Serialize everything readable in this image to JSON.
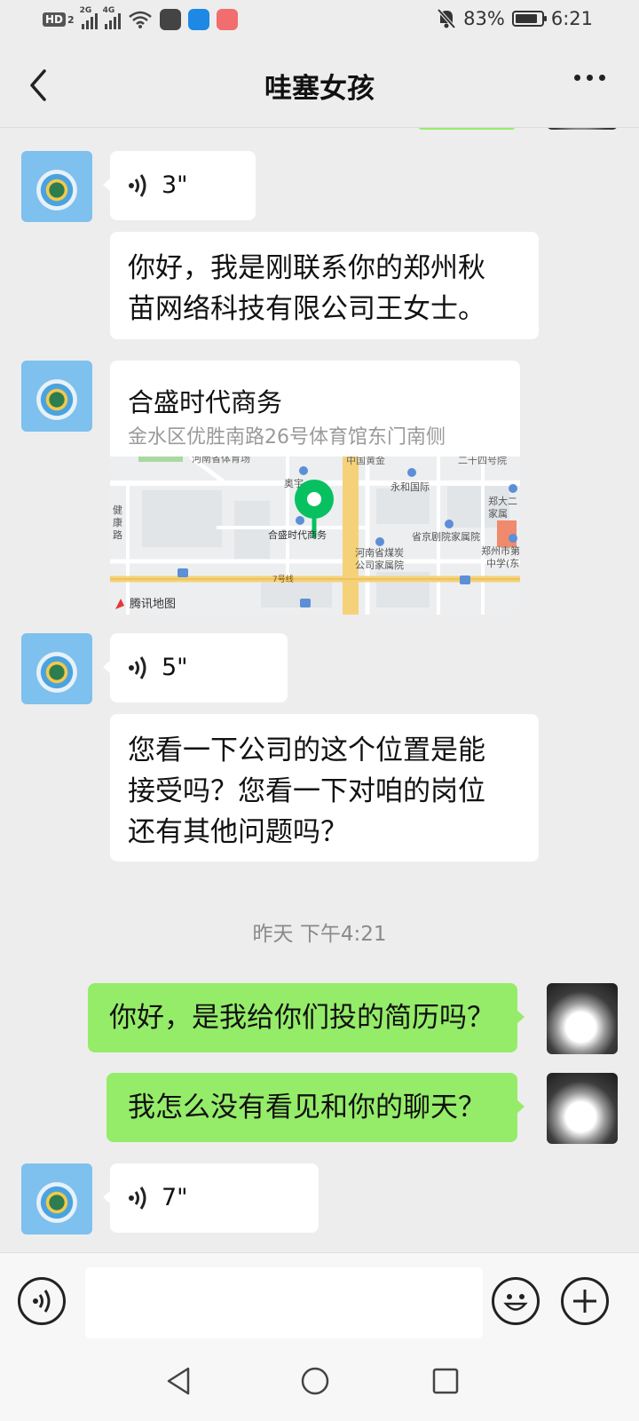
{
  "status_bar": {
    "hd": "HD",
    "hd_sub": "2",
    "sim1": "2G",
    "sim2": "4G",
    "battery_percent": "83%",
    "time": "6:21"
  },
  "nav": {
    "title": "哇塞女孩"
  },
  "messages": [
    {
      "side": "received",
      "type": "voice",
      "duration": "3\""
    },
    {
      "side": "received",
      "type": "text",
      "lines": [
        "你好，我是刚联系你的郑州秋",
        "苗网络科技有限公司王女士。"
      ]
    },
    {
      "side": "received",
      "type": "location",
      "name": "合盛时代商务",
      "address": "金水区优胜南路26号体育馆东门南侧"
    },
    {
      "side": "received",
      "type": "voice",
      "duration": "5\""
    },
    {
      "side": "received",
      "type": "text",
      "lines": [
        "您看一下公司的这个位置是能",
        "接受吗？您看一下对咱的岗位",
        "还有其他问题吗？"
      ]
    },
    {
      "type": "timestamp",
      "text": "昨天 下午4:21"
    },
    {
      "side": "sent",
      "type": "text",
      "text": "你好，是我给你们投的简历吗？"
    },
    {
      "side": "sent",
      "type": "text",
      "text": "我怎么没有看见和你的聊天？"
    },
    {
      "side": "received",
      "type": "voice",
      "duration": "7\""
    }
  ],
  "map": {
    "brand": "腾讯地图",
    "labels": [
      "河南省体育场",
      "中国黄金",
      "二十四号院",
      "奥宇",
      "永和国际",
      "郑大二",
      "家属",
      "健",
      "康",
      "路",
      "合盛时代商务",
      "省京剧院家属院",
      "郑州市第",
      "中学(东",
      "河南省煤炭",
      "公司家属院",
      "7号线"
    ]
  },
  "colors": {
    "green_bubble": "#95ec69",
    "map_pin": "#07c160",
    "road_yellow": "#f5d27a"
  }
}
